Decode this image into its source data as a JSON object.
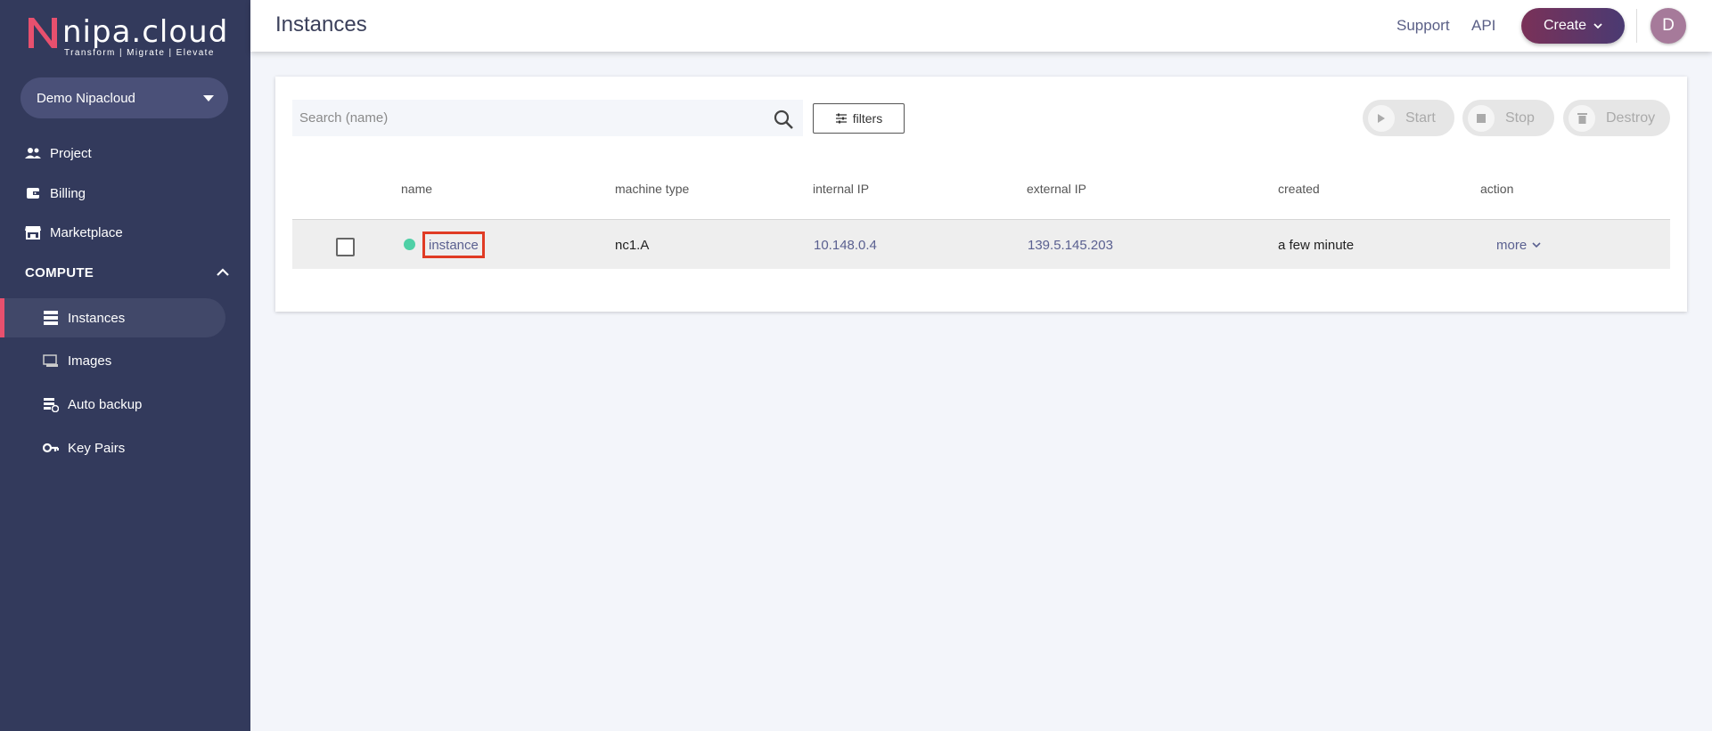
{
  "brand": {
    "name": "nipa.cloud",
    "tagline": "Transform  |  Migrate  |  Elevate",
    "accent": "#e8506e"
  },
  "sidebar": {
    "project": "Demo Nipacloud",
    "top_items": [
      {
        "label": "Project",
        "icon": "users-icon"
      },
      {
        "label": "Billing",
        "icon": "wallet-icon"
      },
      {
        "label": "Marketplace",
        "icon": "store-icon"
      }
    ],
    "section": "COMPUTE",
    "sub_items": [
      {
        "label": "Instances",
        "icon": "server-icon",
        "active": true
      },
      {
        "label": "Images",
        "icon": "monitor-icon"
      },
      {
        "label": "Auto backup",
        "icon": "backup-icon"
      },
      {
        "label": "Key Pairs",
        "icon": "key-icon"
      }
    ]
  },
  "header": {
    "title": "Instances",
    "support": "Support",
    "api": "API",
    "create": "Create",
    "avatar": "D"
  },
  "toolbar": {
    "search_placeholder": "Search (name)",
    "filters": "filters",
    "start": "Start",
    "stop": "Stop",
    "destroy": "Destroy"
  },
  "table": {
    "columns": [
      "name",
      "machine type",
      "internal IP",
      "external IP",
      "created",
      "action"
    ],
    "rows": [
      {
        "name": "instance",
        "machine_type": "nc1.A",
        "internal_ip": "10.148.0.4",
        "external_ip": "139.5.145.203",
        "created": "a few minute",
        "action": "more",
        "status_color": "#4fd0a6"
      }
    ]
  }
}
